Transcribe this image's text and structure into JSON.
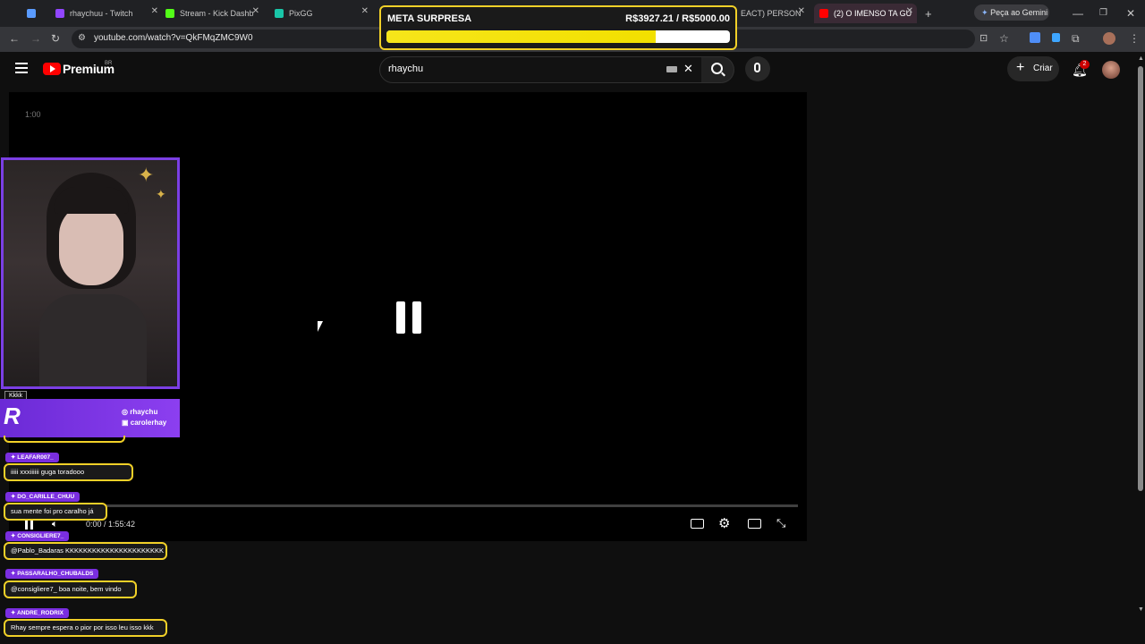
{
  "browser": {
    "tabs": [
      {
        "label": "",
        "fav": "#5a9bff"
      },
      {
        "label": "rhaychuu - Twitch",
        "fav": "#9146ff"
      },
      {
        "label": "Stream - Kick Dashb",
        "fav": "#53fc18"
      },
      {
        "label": "PixGG",
        "fav": "#19c6a8"
      },
      {
        "label": "EACT) PERSON",
        "fav": "#ff0000"
      },
      {
        "label": "(2) O IMENSO TA GU",
        "fav": "#ff0000"
      }
    ],
    "new_tab": "+",
    "gemini": "Peça ao Gemini",
    "url": "youtube.com/watch?v=QkFMqZMC9W0"
  },
  "youtube": {
    "logo_text": "Premium",
    "logo_region": "BR",
    "search_value": "rhaychu",
    "create_label": "Criar",
    "notif_count": "2"
  },
  "player": {
    "time_top": "1:00",
    "time": "0:00 / 1:55:42",
    "paused": true
  },
  "overlay": {
    "goal_title": "META SURPRESA",
    "goal_amount": "R$3927.21 / R$5000.00",
    "goal_fraction": 0.785,
    "banner_handle1": "rhaychu",
    "banner_handle2": "carolerhay",
    "chat_label_top": "Kkkk",
    "chat": [
      {
        "user": "LEAFAR007_",
        "msg": "iiiii xxxiiiiii guga toradooo"
      },
      {
        "user": "DO_CARILLE_CHUU",
        "msg": "sua mente foi pro caralho já"
      },
      {
        "user": "CONSIGLIERE7_",
        "msg": "@Pablo_Badaras KKKKKKKKKKKKKKKKKKKKKK"
      },
      {
        "user": "PASSARALHO_CHUBALDS",
        "msg": "@consigliere7_ boa noite, bem vindo"
      },
      {
        "user": "ANDRE_RODRIX",
        "msg": "Rhay sempre espera o pior por isso leu isso kkk"
      }
    ]
  },
  "colors": {
    "accent_gold": "#f1d028",
    "accent_purple": "#7b3fe4",
    "yt_red": "#ff0000"
  }
}
